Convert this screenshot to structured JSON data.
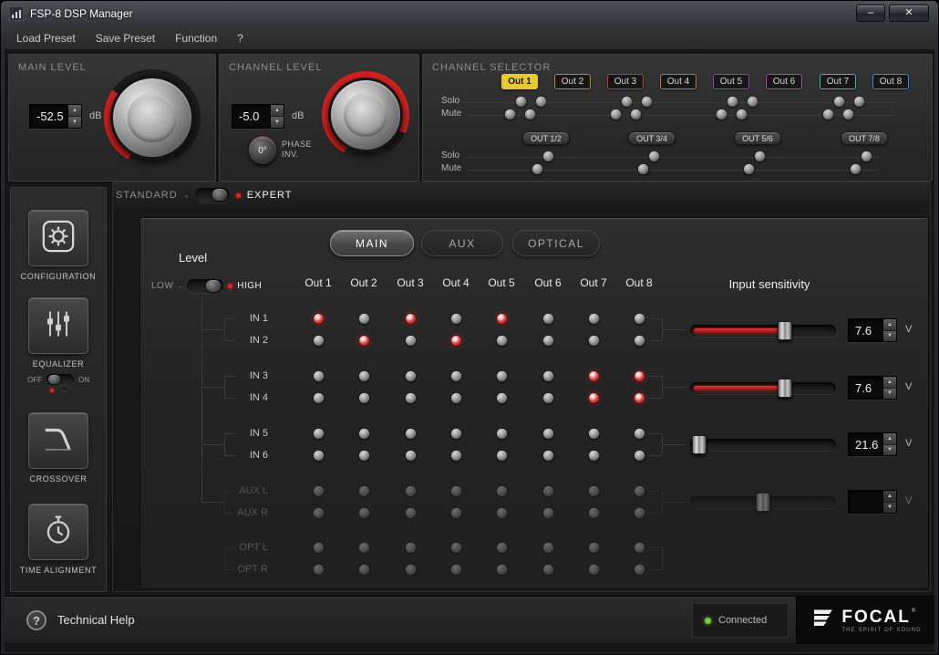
{
  "window": {
    "title": "FSP-8 DSP Manager",
    "minimize": "–",
    "close": "✕"
  },
  "menu": {
    "items": [
      "Load Preset",
      "Save Preset",
      "Function",
      "?"
    ]
  },
  "panels": {
    "main_level": {
      "title": "MAIN LEVEL",
      "value": "-52.5",
      "unit": "dB"
    },
    "channel_level": {
      "title": "CHANNEL LEVEL",
      "value": "-5.0",
      "unit": "dB",
      "phase_value": "0°",
      "phase_line1": "PHASE",
      "phase_line2": "INV."
    },
    "channel_selector": {
      "title": "CHANNEL SELECTOR",
      "solo": "Solo",
      "mute": "Mute",
      "channels": [
        {
          "label": "Out 1",
          "color": "#e6c933",
          "selected": true
        },
        {
          "label": "Out 2",
          "color": "#ab9430",
          "selected": false
        },
        {
          "label": "Out 3",
          "color": "#c03a3a",
          "selected": false
        },
        {
          "label": "Out 4",
          "color": "#c07a35",
          "selected": false
        },
        {
          "label": "Out 5",
          "color": "#8f46c0",
          "selected": false
        },
        {
          "label": "Out 6",
          "color": "#b44ab8",
          "selected": false
        },
        {
          "label": "Out 7",
          "color": "#3bbcb4",
          "selected": false
        },
        {
          "label": "Out 8",
          "color": "#3f8fd0",
          "selected": false
        }
      ],
      "groups": [
        "OUT 1/2",
        "OUT 3/4",
        "OUT 5/6",
        "OUT 7/8"
      ]
    }
  },
  "sidebar": {
    "configuration": "CONFIGURATION",
    "equalizer": "EQUALIZER",
    "eq_off": "OFF",
    "eq_on": "ON",
    "crossover": "CROSSOVER",
    "time_alignment": "TIME ALIGNMENT"
  },
  "mode": {
    "standard": "STANDARD",
    "expert": "EXPERT"
  },
  "router": {
    "tabs": [
      {
        "label": "MAIN",
        "active": true
      },
      {
        "label": "AUX",
        "active": false
      },
      {
        "label": "OPTICAL",
        "active": false
      }
    ],
    "level": {
      "label": "Level",
      "low": "LOW",
      "high": "HIGH"
    },
    "columns": [
      "Out 1",
      "Out 2",
      "Out 3",
      "Out 4",
      "Out 5",
      "Out 6",
      "Out 7",
      "Out 8"
    ],
    "rows": [
      {
        "label": "IN 1",
        "enabled": true,
        "cells": [
          1,
          0,
          1,
          0,
          1,
          0,
          0,
          0
        ]
      },
      {
        "label": "IN 2",
        "enabled": true,
        "cells": [
          0,
          1,
          0,
          1,
          0,
          0,
          0,
          0
        ]
      },
      {
        "label": "IN 3",
        "enabled": true,
        "cells": [
          0,
          0,
          0,
          0,
          0,
          0,
          1,
          1
        ]
      },
      {
        "label": "IN 4",
        "enabled": true,
        "cells": [
          0,
          0,
          0,
          0,
          0,
          0,
          1,
          1
        ]
      },
      {
        "label": "IN 5",
        "enabled": true,
        "cells": [
          0,
          0,
          0,
          0,
          0,
          0,
          0,
          0
        ]
      },
      {
        "label": "IN 6",
        "enabled": true,
        "cells": [
          0,
          0,
          0,
          0,
          0,
          0,
          0,
          0
        ]
      },
      {
        "label": "AUX L",
        "enabled": false,
        "cells": [
          0,
          0,
          0,
          0,
          0,
          0,
          0,
          0
        ]
      },
      {
        "label": "AUX R",
        "enabled": false,
        "cells": [
          0,
          0,
          0,
          0,
          0,
          0,
          0,
          0
        ]
      },
      {
        "label": "OPT L",
        "enabled": false,
        "cells": [
          0,
          0,
          0,
          0,
          0,
          0,
          0,
          0
        ]
      },
      {
        "label": "OPT R",
        "enabled": false,
        "cells": [
          0,
          0,
          0,
          0,
          0,
          0,
          0,
          0
        ]
      }
    ],
    "sensitivity": {
      "label": "Input sensitivity",
      "unit": "V",
      "sliders": [
        {
          "value": "7.6",
          "percent": 65,
          "enabled": true
        },
        {
          "value": "7.6",
          "percent": 65,
          "enabled": true
        },
        {
          "value": "21.6",
          "percent": 6,
          "enabled": true
        },
        {
          "value": "",
          "percent": 50,
          "enabled": false
        }
      ]
    }
  },
  "footer": {
    "help": "Technical Help",
    "status": "Connected",
    "status_color": "#7dc63e",
    "brand": "FOCAL",
    "brand_reg": "®",
    "tagline": "THE SPIRIT OF SOUND"
  }
}
